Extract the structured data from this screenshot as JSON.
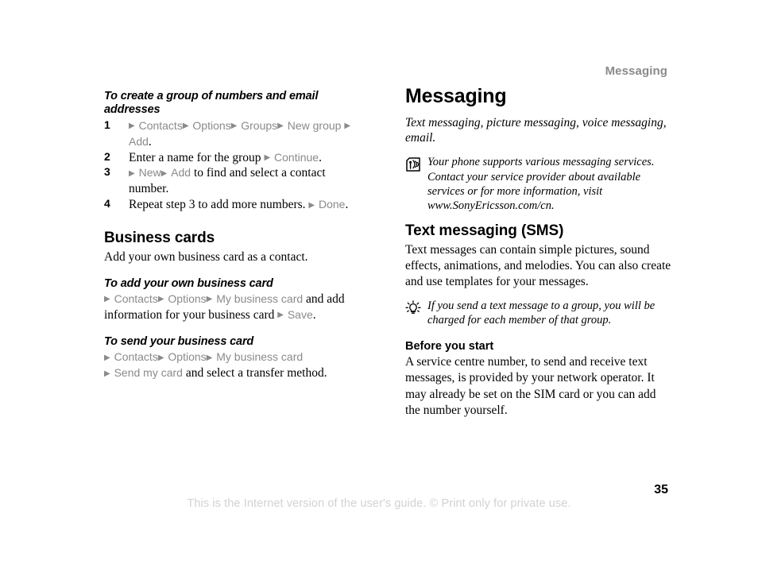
{
  "header": {
    "running_title": "Messaging"
  },
  "left_column": {
    "task1": {
      "title": "To create a group of numbers and email addresses",
      "steps": [
        {
          "num": "1",
          "parts": [
            {
              "t": "arrow"
            },
            {
              "t": "ui",
              "v": "Contacts"
            },
            {
              "t": "arrow"
            },
            {
              "t": "ui",
              "v": "Options"
            },
            {
              "t": "arrow"
            },
            {
              "t": "ui",
              "v": "Groups"
            },
            {
              "t": "arrow"
            },
            {
              "t": "ui",
              "v": "New group"
            },
            {
              "t": "text",
              "v": " "
            },
            {
              "t": "arrow"
            },
            {
              "t": "ui",
              "v": "Add"
            },
            {
              "t": "text",
              "v": "."
            }
          ]
        },
        {
          "num": "2",
          "parts": [
            {
              "t": "text",
              "v": "Enter a name for the group "
            },
            {
              "t": "arrow"
            },
            {
              "t": "ui",
              "v": "Continue"
            },
            {
              "t": "text",
              "v": "."
            }
          ]
        },
        {
          "num": "3",
          "parts": [
            {
              "t": "arrow"
            },
            {
              "t": "ui",
              "v": "New"
            },
            {
              "t": "arrow"
            },
            {
              "t": "ui",
              "v": "Add"
            },
            {
              "t": "text",
              "v": " to find and select a contact number."
            }
          ]
        },
        {
          "num": "4",
          "parts": [
            {
              "t": "text",
              "v": "Repeat step 3 to add more numbers. "
            },
            {
              "t": "arrow"
            },
            {
              "t": "ui",
              "v": "Done"
            },
            {
              "t": "text",
              "v": "."
            }
          ]
        }
      ]
    },
    "section": {
      "title": "Business cards",
      "intro": "Add your own business card as a contact."
    },
    "task2": {
      "title": "To add your own business card",
      "parts": [
        {
          "t": "arrow"
        },
        {
          "t": "ui",
          "v": "Contacts"
        },
        {
          "t": "arrow"
        },
        {
          "t": "ui",
          "v": "Options"
        },
        {
          "t": "arrow"
        },
        {
          "t": "ui",
          "v": "My business card"
        },
        {
          "t": "text",
          "v": " and add information for your business card "
        },
        {
          "t": "arrow"
        },
        {
          "t": "ui",
          "v": "Save"
        },
        {
          "t": "text",
          "v": "."
        }
      ]
    },
    "task3": {
      "title": "To send your business card",
      "parts": [
        {
          "t": "arrow"
        },
        {
          "t": "ui",
          "v": "Contacts"
        },
        {
          "t": "arrow"
        },
        {
          "t": "ui",
          "v": "Options"
        },
        {
          "t": "arrow"
        },
        {
          "t": "ui",
          "v": "My business card"
        },
        {
          "t": "br"
        },
        {
          "t": "arrow"
        },
        {
          "t": "ui",
          "v": "Send my card"
        },
        {
          "t": "text",
          "v": " and select a transfer method."
        }
      ]
    }
  },
  "right_column": {
    "chapter_title": "Messaging",
    "chapter_intro": "Text messaging, picture messaging, voice messaging, email.",
    "note_service": {
      "icon": "signal-waves-icon",
      "text": "Your phone supports various messaging services. Contact your service provider about available services or for more information, visit www.SonyEricsson.com/cn."
    },
    "section_sms": {
      "title": "Text messaging (SMS)",
      "body": "Text messages can contain simple pictures, sound effects, animations, and melodies. You can also create and use templates for your messages."
    },
    "note_tip": {
      "icon": "lightbulb-tip-icon",
      "text": "If you send a text message to a group, you will be charged for each member of that group."
    },
    "before_you_start": {
      "title": "Before you start",
      "body": "A service centre number, to send and receive text messages, is provided by your network operator. It may already be set on the SIM card or you can add the number yourself."
    }
  },
  "footer": {
    "page_number": "35",
    "disclaimer": "This is the Internet version of the user's guide. © Print only for private use."
  },
  "colors": {
    "ui_reference_gray": "#8a8a8a",
    "running_header_gray": "#8a8a8a",
    "footer_gray": "#d2d2d2",
    "text_black": "#000000"
  }
}
